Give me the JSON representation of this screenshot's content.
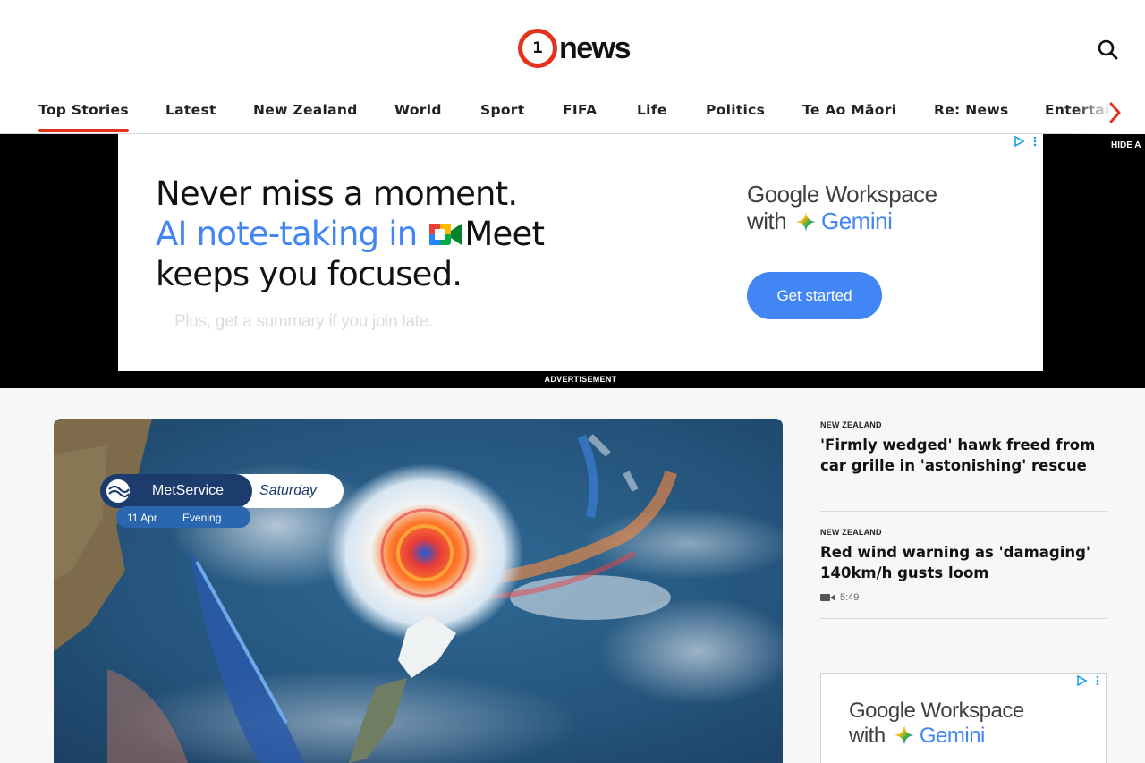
{
  "header": {
    "logo_number": "1",
    "logo_word": "news",
    "search_icon": "search-icon"
  },
  "nav": {
    "items": [
      {
        "label": "Top Stories",
        "active": true
      },
      {
        "label": "Latest"
      },
      {
        "label": "New Zealand"
      },
      {
        "label": "World"
      },
      {
        "label": "Sport"
      },
      {
        "label": "FIFA"
      },
      {
        "label": "Life"
      },
      {
        "label": "Politics"
      },
      {
        "label": "Te Ao Māori"
      },
      {
        "label": "Re: News"
      },
      {
        "label": "Entertai"
      }
    ],
    "more_icon": "chevron-right-icon",
    "accent": "#e4321b"
  },
  "advert": {
    "line1": "Never miss a moment.",
    "line2_blue": "AI note-taking in",
    "line2_product": "Meet",
    "line3": "keeps you focused.",
    "subline": "Plus, get a summary if you join late.",
    "brand_line1": "Google Workspace",
    "brand_with": "with",
    "brand_gemini": "Gemini",
    "cta": "Get started",
    "hide_label": "HIDE A",
    "ad_label": "ADVERTISEMENT",
    "cta_color": "#4285f4"
  },
  "hero": {
    "badge_name": "MetService",
    "badge_day": "Saturday",
    "badge_date": "11 Apr",
    "badge_time": "Evening"
  },
  "stories": [
    {
      "category": "NEW ZEALAND",
      "headline": "'Firmly wedged' hawk freed from car grille in 'astonishing' rescue"
    },
    {
      "category": "NEW ZEALAND",
      "headline": "Red wind warning as 'damaging' 140km/h gusts loom",
      "video_duration": "5:49"
    }
  ],
  "side_ad": {
    "brand_line1": "Google Workspace",
    "brand_with": "with",
    "brand_gemini": "Gemini"
  }
}
